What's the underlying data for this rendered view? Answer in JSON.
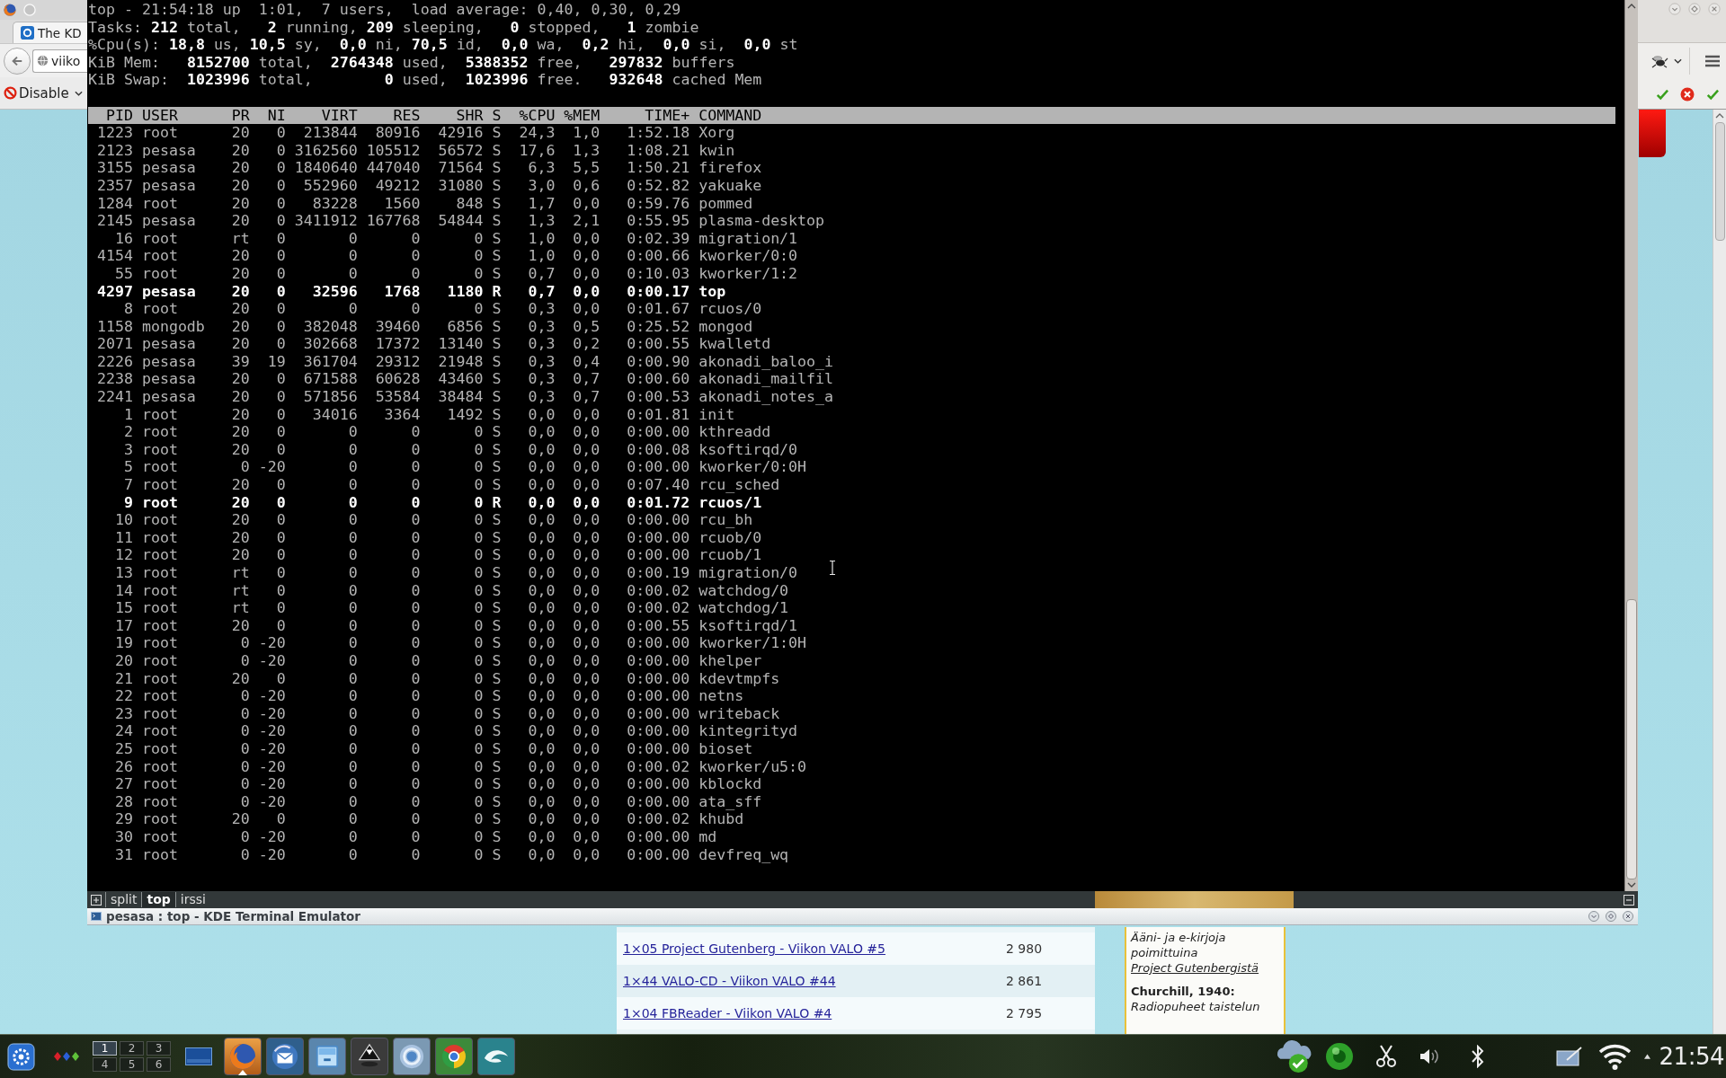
{
  "browser": {
    "tab": {
      "title": "The KD"
    },
    "address_bar": {
      "value": "viiko"
    },
    "toolbar_button": {
      "label": "Disable"
    },
    "page": {
      "list": [
        {
          "link": "1×05 Project Gutenberg - Viikon VALO #5",
          "count": "2 980"
        },
        {
          "link": "1×44 VALO-CD - Viikon VALO #44",
          "count": "2 861"
        },
        {
          "link": "1×04 FBReader - Viikon VALO #4",
          "count": "2 795"
        }
      ],
      "sidebar": {
        "intro": "Ääni- ja e-kirjoja poimittuina",
        "intro_link": "Project Gutenbergistä",
        "heading": "Churchill, 1940:",
        "teaser": "Radiopuheet taistelun"
      }
    }
  },
  "terminal": {
    "summary": [
      "top - 21:54:18 up  1:01,  7 users,  load average: 0,40, 0,30, 0,29",
      "Tasks: **212** total,   **2** running, **209** sleeping,   **0** stopped,   **1** zombie",
      "%Cpu(s): **18,8** us, **10,5** sy,  **0,0** ni, **70,5** id,  **0,0** wa,  **0,2** hi,  **0,0** si,  **0,0** st",
      "KiB Mem:   **8152700** total,  **2764348** used,  **5388352** free,   **297832** buffers",
      "KiB Swap:  **1023996** total,        **0** used,  **1023996** free.   **932648** cached Mem"
    ],
    "columns": [
      "PID",
      "USER",
      "PR",
      "NI",
      "VIRT",
      "RES",
      "SHR",
      "S",
      "%CPU",
      "%MEM",
      "TIME+",
      "COMMAND"
    ],
    "rows": [
      {
        "cells": [
          "1223",
          "root",
          "20",
          "0",
          "213844",
          "80916",
          "42916",
          "S",
          "24,3",
          "1,0",
          "1:52.18",
          "Xorg"
        ],
        "highlighted": false
      },
      {
        "cells": [
          "2123",
          "pesasa",
          "20",
          "0",
          "3162560",
          "105512",
          "56572",
          "S",
          "17,6",
          "1,3",
          "1:08.21",
          "kwin"
        ],
        "highlighted": false
      },
      {
        "cells": [
          "3155",
          "pesasa",
          "20",
          "0",
          "1840640",
          "447040",
          "71564",
          "S",
          "6,3",
          "5,5",
          "1:50.21",
          "firefox"
        ],
        "highlighted": false
      },
      {
        "cells": [
          "2357",
          "pesasa",
          "20",
          "0",
          "552960",
          "49212",
          "31080",
          "S",
          "3,0",
          "0,6",
          "0:52.82",
          "yakuake"
        ],
        "highlighted": false
      },
      {
        "cells": [
          "1284",
          "root",
          "20",
          "0",
          "83228",
          "1560",
          "848",
          "S",
          "1,7",
          "0,0",
          "0:59.76",
          "pommed"
        ],
        "highlighted": false
      },
      {
        "cells": [
          "2145",
          "pesasa",
          "20",
          "0",
          "3411912",
          "167768",
          "54844",
          "S",
          "1,3",
          "2,1",
          "0:55.95",
          "plasma-desktop"
        ],
        "highlighted": false
      },
      {
        "cells": [
          "16",
          "root",
          "rt",
          "0",
          "0",
          "0",
          "0",
          "S",
          "1,0",
          "0,0",
          "0:02.39",
          "migration/1"
        ],
        "highlighted": false
      },
      {
        "cells": [
          "4154",
          "root",
          "20",
          "0",
          "0",
          "0",
          "0",
          "S",
          "1,0",
          "0,0",
          "0:00.66",
          "kworker/0:0"
        ],
        "highlighted": false
      },
      {
        "cells": [
          "55",
          "root",
          "20",
          "0",
          "0",
          "0",
          "0",
          "S",
          "0,7",
          "0,0",
          "0:10.03",
          "kworker/1:2"
        ],
        "highlighted": false
      },
      {
        "cells": [
          "4297",
          "pesasa",
          "20",
          "0",
          "32596",
          "1768",
          "1180",
          "R",
          "0,7",
          "0,0",
          "0:00.17",
          "top"
        ],
        "highlighted": true
      },
      {
        "cells": [
          "8",
          "root",
          "20",
          "0",
          "0",
          "0",
          "0",
          "S",
          "0,3",
          "0,0",
          "0:01.67",
          "rcuos/0"
        ],
        "highlighted": false
      },
      {
        "cells": [
          "1158",
          "mongodb",
          "20",
          "0",
          "382048",
          "39460",
          "6856",
          "S",
          "0,3",
          "0,5",
          "0:25.52",
          "mongod"
        ],
        "highlighted": false
      },
      {
        "cells": [
          "2071",
          "pesasa",
          "20",
          "0",
          "302668",
          "17372",
          "13140",
          "S",
          "0,3",
          "0,2",
          "0:00.55",
          "kwalletd"
        ],
        "highlighted": false
      },
      {
        "cells": [
          "2226",
          "pesasa",
          "39",
          "19",
          "361704",
          "29312",
          "21948",
          "S",
          "0,3",
          "0,4",
          "0:00.90",
          "akonadi_baloo_i"
        ],
        "highlighted": false
      },
      {
        "cells": [
          "2238",
          "pesasa",
          "20",
          "0",
          "671588",
          "60628",
          "43460",
          "S",
          "0,3",
          "0,7",
          "0:00.60",
          "akonadi_mailfil"
        ],
        "highlighted": false
      },
      {
        "cells": [
          "2241",
          "pesasa",
          "20",
          "0",
          "571856",
          "53584",
          "38484",
          "S",
          "0,3",
          "0,7",
          "0:00.53",
          "akonadi_notes_a"
        ],
        "highlighted": false
      },
      {
        "cells": [
          "1",
          "root",
          "20",
          "0",
          "34016",
          "3364",
          "1492",
          "S",
          "0,0",
          "0,0",
          "0:01.81",
          "init"
        ],
        "highlighted": false
      },
      {
        "cells": [
          "2",
          "root",
          "20",
          "0",
          "0",
          "0",
          "0",
          "S",
          "0,0",
          "0,0",
          "0:00.00",
          "kthreadd"
        ],
        "highlighted": false
      },
      {
        "cells": [
          "3",
          "root",
          "20",
          "0",
          "0",
          "0",
          "0",
          "S",
          "0,0",
          "0,0",
          "0:00.08",
          "ksoftirqd/0"
        ],
        "highlighted": false
      },
      {
        "cells": [
          "5",
          "root",
          "0",
          "-20",
          "0",
          "0",
          "0",
          "S",
          "0,0",
          "0,0",
          "0:00.00",
          "kworker/0:0H"
        ],
        "highlighted": false
      },
      {
        "cells": [
          "7",
          "root",
          "20",
          "0",
          "0",
          "0",
          "0",
          "S",
          "0,0",
          "0,0",
          "0:07.40",
          "rcu_sched"
        ],
        "highlighted": false
      },
      {
        "cells": [
          "9",
          "root",
          "20",
          "0",
          "0",
          "0",
          "0",
          "R",
          "0,0",
          "0,0",
          "0:01.72",
          "rcuos/1"
        ],
        "highlighted": true
      },
      {
        "cells": [
          "10",
          "root",
          "20",
          "0",
          "0",
          "0",
          "0",
          "S",
          "0,0",
          "0,0",
          "0:00.00",
          "rcu_bh"
        ],
        "highlighted": false
      },
      {
        "cells": [
          "11",
          "root",
          "20",
          "0",
          "0",
          "0",
          "0",
          "S",
          "0,0",
          "0,0",
          "0:00.00",
          "rcuob/0"
        ],
        "highlighted": false
      },
      {
        "cells": [
          "12",
          "root",
          "20",
          "0",
          "0",
          "0",
          "0",
          "S",
          "0,0",
          "0,0",
          "0:00.00",
          "rcuob/1"
        ],
        "highlighted": false
      },
      {
        "cells": [
          "13",
          "root",
          "rt",
          "0",
          "0",
          "0",
          "0",
          "S",
          "0,0",
          "0,0",
          "0:00.19",
          "migration/0"
        ],
        "highlighted": false
      },
      {
        "cells": [
          "14",
          "root",
          "rt",
          "0",
          "0",
          "0",
          "0",
          "S",
          "0,0",
          "0,0",
          "0:00.02",
          "watchdog/0"
        ],
        "highlighted": false
      },
      {
        "cells": [
          "15",
          "root",
          "rt",
          "0",
          "0",
          "0",
          "0",
          "S",
          "0,0",
          "0,0",
          "0:00.02",
          "watchdog/1"
        ],
        "highlighted": false
      },
      {
        "cells": [
          "17",
          "root",
          "20",
          "0",
          "0",
          "0",
          "0",
          "S",
          "0,0",
          "0,0",
          "0:00.55",
          "ksoftirqd/1"
        ],
        "highlighted": false
      },
      {
        "cells": [
          "19",
          "root",
          "0",
          "-20",
          "0",
          "0",
          "0",
          "S",
          "0,0",
          "0,0",
          "0:00.00",
          "kworker/1:0H"
        ],
        "highlighted": false
      },
      {
        "cells": [
          "20",
          "root",
          "0",
          "-20",
          "0",
          "0",
          "0",
          "S",
          "0,0",
          "0,0",
          "0:00.00",
          "khelper"
        ],
        "highlighted": false
      },
      {
        "cells": [
          "21",
          "root",
          "20",
          "0",
          "0",
          "0",
          "0",
          "S",
          "0,0",
          "0,0",
          "0:00.00",
          "kdevtmpfs"
        ],
        "highlighted": false
      },
      {
        "cells": [
          "22",
          "root",
          "0",
          "-20",
          "0",
          "0",
          "0",
          "S",
          "0,0",
          "0,0",
          "0:00.00",
          "netns"
        ],
        "highlighted": false
      },
      {
        "cells": [
          "23",
          "root",
          "0",
          "-20",
          "0",
          "0",
          "0",
          "S",
          "0,0",
          "0,0",
          "0:00.00",
          "writeback"
        ],
        "highlighted": false
      },
      {
        "cells": [
          "24",
          "root",
          "0",
          "-20",
          "0",
          "0",
          "0",
          "S",
          "0,0",
          "0,0",
          "0:00.00",
          "kintegrityd"
        ],
        "highlighted": false
      },
      {
        "cells": [
          "25",
          "root",
          "0",
          "-20",
          "0",
          "0",
          "0",
          "S",
          "0,0",
          "0,0",
          "0:00.00",
          "bioset"
        ],
        "highlighted": false
      },
      {
        "cells": [
          "26",
          "root",
          "0",
          "-20",
          "0",
          "0",
          "0",
          "S",
          "0,0",
          "0,0",
          "0:00.02",
          "kworker/u5:0"
        ],
        "highlighted": false
      },
      {
        "cells": [
          "27",
          "root",
          "0",
          "-20",
          "0",
          "0",
          "0",
          "S",
          "0,0",
          "0,0",
          "0:00.00",
          "kblockd"
        ],
        "highlighted": false
      },
      {
        "cells": [
          "28",
          "root",
          "0",
          "-20",
          "0",
          "0",
          "0",
          "S",
          "0,0",
          "0,0",
          "0:00.00",
          "ata_sff"
        ],
        "highlighted": false
      },
      {
        "cells": [
          "29",
          "root",
          "20",
          "0",
          "0",
          "0",
          "0",
          "S",
          "0,0",
          "0,0",
          "0:00.02",
          "khubd"
        ],
        "highlighted": false
      },
      {
        "cells": [
          "30",
          "root",
          "0",
          "-20",
          "0",
          "0",
          "0",
          "S",
          "0,0",
          "0,0",
          "0:00.00",
          "md"
        ],
        "highlighted": false
      },
      {
        "cells": [
          "31",
          "root",
          "0",
          "-20",
          "0",
          "0",
          "0",
          "S",
          "0,0",
          "0,0",
          "0:00.00",
          "devfreq_wq"
        ],
        "highlighted": false
      }
    ],
    "tabs": [
      {
        "label": "split",
        "selected": false
      },
      {
        "label": "top",
        "selected": true
      },
      {
        "label": "irssi",
        "selected": false
      }
    ],
    "title": "pesasa : top - KDE Terminal Emulator"
  },
  "taskbar": {
    "pager": [
      {
        "label": "1",
        "selected": true
      },
      {
        "label": "2",
        "selected": false
      },
      {
        "label": "3",
        "selected": false
      },
      {
        "label": "4",
        "selected": false
      },
      {
        "label": "5",
        "selected": false
      },
      {
        "label": "6",
        "selected": false
      }
    ],
    "tasks": [
      {
        "kind": "globe",
        "active": true
      },
      {
        "kind": "bird",
        "active": false
      },
      {
        "kind": "drawer",
        "active": false
      },
      {
        "kind": "ink",
        "active": false
      },
      {
        "kind": "ring",
        "active": false
      },
      {
        "kind": "wheel",
        "active": false
      },
      {
        "kind": "wave",
        "active": false
      }
    ],
    "clock": "21:54"
  }
}
